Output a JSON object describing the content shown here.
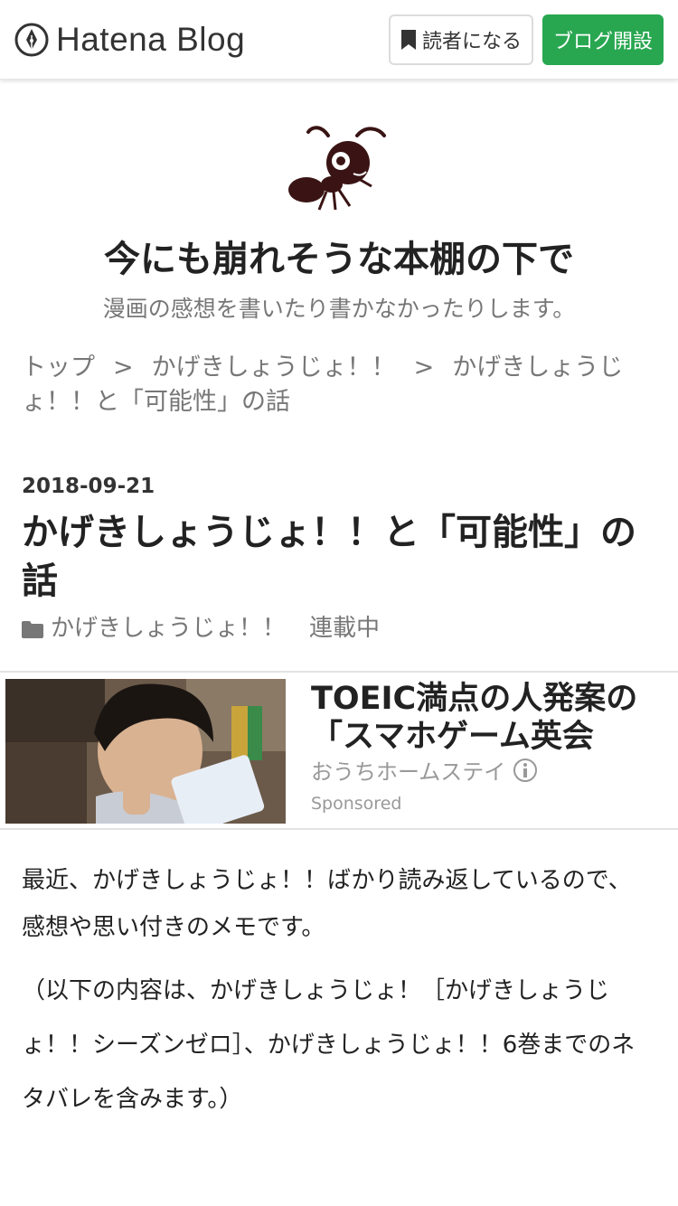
{
  "header": {
    "logo_text": "Hatena Blog",
    "reader_button": "読者になる",
    "open_blog_button": "ブログ開設",
    "accent_color": "#28a750"
  },
  "blog": {
    "title": "今にも崩れそうな本棚の下で",
    "description": "漫画の感想を書いたり書かなかったりします。"
  },
  "breadcrumb": {
    "items": [
      "トップ",
      "かげきしょうじょ！！",
      "かげきしょうじょ！！と「可能性」の話"
    ],
    "separator": ">"
  },
  "entry": {
    "date": "2018-09-21",
    "title": "かげきしょうじょ！！と「可能性」の話",
    "categories": [
      "かげきしょうじょ！！",
      "連載中"
    ]
  },
  "ad": {
    "title": "TOEIC満点の人発案の「スマホゲーム英会",
    "source": "おうちホームステイ",
    "sponsored": "Sponsored"
  },
  "body": {
    "paragraphs": [
      "最近、かげきしょうじょ！！ばかり読み返しているので、感想や思い付きのメモです。",
      "（以下の内容は、かげきしょうじょ！［かげきしょうじょ！！シーズンゼロ］、かげきしょうじょ！！6巻までのネタバレを含みます。）"
    ]
  }
}
